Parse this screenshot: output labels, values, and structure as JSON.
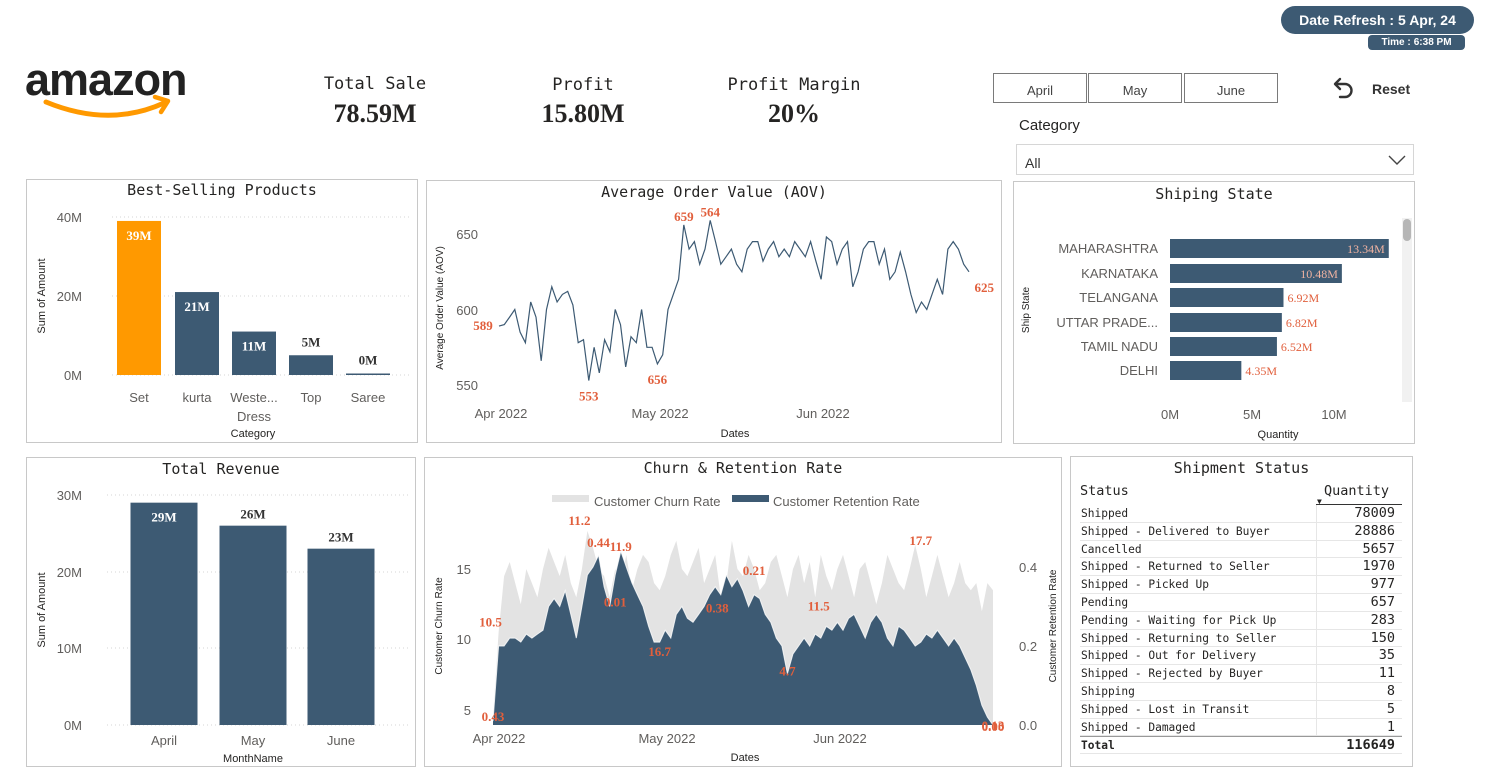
{
  "header": {
    "date_refresh_label": "Date Refresh :",
    "date_refresh_value": "5 Apr, 24",
    "time_label": "Time :",
    "time_value": "6:38 PM",
    "logo_text": "amazon"
  },
  "kpis": [
    {
      "label": "Total Sale",
      "value": "78.59M"
    },
    {
      "label": "Profit",
      "value": "15.80M"
    },
    {
      "label": "Profit Margin",
      "value": "20%"
    }
  ],
  "filters": {
    "months": [
      "April",
      "May",
      "June"
    ],
    "reset_label": "Reset",
    "category_label": "Category",
    "category_value": "All"
  },
  "colors": {
    "accent_orange": "#ff9900",
    "bar_dark": "#3d5a73",
    "label_red": "#e15f3c",
    "churn_grey": "#e3e3e3"
  },
  "best_selling": {
    "title": "Best-Selling Products",
    "ylabel": "Sum of Amount",
    "xlabel": "Category",
    "yticks": [
      "40M",
      "20M",
      "0M"
    ],
    "labels": [
      "39M",
      "21M",
      "11M",
      "5M",
      "0M"
    ],
    "cat_labels": [
      "Set",
      "kurta",
      "Weste...",
      "Top",
      "Saree"
    ],
    "cat_sublabel": "Dress"
  },
  "aov": {
    "title": "Average Order Value (AOV)",
    "ylabel": "Average Order Value (AOV)",
    "xlabel": "Dates",
    "yticks": [
      "650",
      "600",
      "550"
    ],
    "xticks": [
      "Apr 2022",
      "May 2022",
      "Jun 2022"
    ],
    "point_labels": [
      "589",
      "553",
      "656",
      "659",
      "564",
      "625"
    ]
  },
  "ship_state": {
    "title": "Shiping State",
    "ylabel": "Ship State",
    "xlabel": "Quantity",
    "xticks": [
      "0M",
      "5M",
      "10M"
    ],
    "states": [
      "MAHARASHTRA",
      "KARNATAKA",
      "TELANGANA",
      "UTTAR PRADE...",
      "TAMIL NADU",
      "DELHI"
    ],
    "labels": [
      "13.34M",
      "10.48M",
      "6.92M",
      "6.82M",
      "6.52M",
      "4.35M"
    ]
  },
  "total_revenue": {
    "title": "Total Revenue",
    "ylabel": "Sum of Amount",
    "xlabel": "MonthName",
    "yticks": [
      "30M",
      "20M",
      "10M",
      "0M"
    ],
    "labels": [
      "29M",
      "26M",
      "23M"
    ],
    "months": [
      "April",
      "May",
      "June"
    ]
  },
  "churn": {
    "title": "Churn & Retention Rate",
    "legend_churn": "Customer Churn Rate",
    "legend_retention": "Customer Retention Rate",
    "ylabel_left": "Customer Churn Rate",
    "ylabel_right": "Customer Retention Rate",
    "xlabel": "Dates",
    "yticks_left": [
      "15",
      "10",
      "5"
    ],
    "yticks_right": [
      "0.4",
      "0.2",
      "0.0"
    ],
    "xticks": [
      "Apr 2022",
      "May 2022",
      "Jun 2022"
    ],
    "point_labels": [
      "10.5",
      "0.01",
      "17.7",
      "0.43",
      "0.44",
      "11.9",
      "0.21",
      "11.2",
      "0.38",
      "11.5",
      "0.13",
      "16.7",
      "4.7",
      "0.00"
    ]
  },
  "shipment_status": {
    "title": "Shipment Status",
    "col_status": "Status",
    "col_quantity": "Quantity",
    "sort_indicator": "▼",
    "rows": [
      {
        "status": "Shipped",
        "qty": "78009"
      },
      {
        "status": "Shipped - Delivered to Buyer",
        "qty": "28886"
      },
      {
        "status": "Cancelled",
        "qty": "5657"
      },
      {
        "status": "Shipped - Returned to Seller",
        "qty": "1970"
      },
      {
        "status": "Shipped - Picked Up",
        "qty": "977"
      },
      {
        "status": "Pending",
        "qty": "657"
      },
      {
        "status": "Pending - Waiting for Pick Up",
        "qty": "283"
      },
      {
        "status": "Shipped - Returning to Seller",
        "qty": "150"
      },
      {
        "status": "Shipped - Out for Delivery",
        "qty": "35"
      },
      {
        "status": "Shipped - Rejected by Buyer",
        "qty": "11"
      },
      {
        "status": "Shipping",
        "qty": "8"
      },
      {
        "status": "Shipped - Lost in Transit",
        "qty": "5"
      },
      {
        "status": "Shipped - Damaged",
        "qty": "1"
      }
    ],
    "total_label": "Total",
    "total_value": "116649"
  },
  "chart_data": [
    {
      "type": "bar",
      "title": "Best-Selling Products",
      "categories": [
        "Set",
        "kurta",
        "Western Dress",
        "Top",
        "Saree"
      ],
      "values": [
        39,
        21,
        11,
        5,
        0.1
      ],
      "unit": "M",
      "xlabel": "Category",
      "ylabel": "Sum of Amount",
      "ylim": [
        0,
        40
      ],
      "highlight": "Set"
    },
    {
      "type": "line",
      "title": "Average Order Value (AOV)",
      "x": [
        "2022-03-31",
        "2022-04-01",
        "2022-04-02",
        "2022-04-03",
        "2022-04-04",
        "2022-04-05",
        "2022-04-06",
        "2022-04-07",
        "2022-04-08",
        "2022-04-09",
        "2022-04-10",
        "2022-04-11",
        "2022-04-12",
        "2022-04-13",
        "2022-04-14",
        "2022-04-15",
        "2022-04-16",
        "2022-04-17",
        "2022-04-18",
        "2022-04-19",
        "2022-04-20",
        "2022-04-21",
        "2022-04-22",
        "2022-04-23",
        "2022-04-24",
        "2022-04-25",
        "2022-04-26",
        "2022-04-27",
        "2022-04-28",
        "2022-04-29",
        "2022-04-30",
        "2022-05-01",
        "2022-05-02",
        "2022-05-03",
        "2022-05-04",
        "2022-05-05",
        "2022-05-06",
        "2022-05-07",
        "2022-05-08",
        "2022-05-09",
        "2022-05-10",
        "2022-05-11",
        "2022-05-12",
        "2022-05-13",
        "2022-05-14",
        "2022-05-15",
        "2022-05-16",
        "2022-05-17",
        "2022-05-18",
        "2022-05-19",
        "2022-05-20",
        "2022-05-21",
        "2022-05-22",
        "2022-05-23",
        "2022-05-24",
        "2022-05-25",
        "2022-05-26",
        "2022-05-27",
        "2022-05-28",
        "2022-05-29",
        "2022-05-30",
        "2022-05-31",
        "2022-06-01",
        "2022-06-02",
        "2022-06-03",
        "2022-06-04",
        "2022-06-05",
        "2022-06-06",
        "2022-06-07",
        "2022-06-08",
        "2022-06-09",
        "2022-06-10",
        "2022-06-11",
        "2022-06-12",
        "2022-06-13",
        "2022-06-14",
        "2022-06-15",
        "2022-06-16",
        "2022-06-17",
        "2022-06-18",
        "2022-06-19",
        "2022-06-20",
        "2022-06-21",
        "2022-06-22",
        "2022-06-23",
        "2022-06-24",
        "2022-06-25",
        "2022-06-26",
        "2022-06-27",
        "2022-06-28",
        "2022-06-29"
      ],
      "values": [
        589,
        590,
        595,
        600,
        585,
        578,
        605,
        595,
        566,
        600,
        615,
        605,
        610,
        612,
        603,
        578,
        580,
        553,
        575,
        558,
        580,
        572,
        600,
        590,
        562,
        582,
        578,
        600,
        575,
        575,
        564,
        570,
        600,
        610,
        620,
        656,
        640,
        645,
        630,
        640,
        659,
        645,
        630,
        635,
        640,
        630,
        625,
        640,
        645,
        645,
        632,
        640,
        645,
        635,
        640,
        635,
        645,
        640,
        635,
        645,
        632,
        620,
        648,
        645,
        630,
        640,
        645,
        615,
        625,
        640,
        645,
        645,
        630,
        640,
        620,
        625,
        638,
        625,
        610,
        598,
        605,
        600,
        610,
        620,
        610,
        640,
        645,
        640,
        630,
        625
      ],
      "xlabel": "Dates",
      "ylabel": "Average Order Value (AOV)",
      "ylim": [
        545,
        660
      ],
      "labeled_points": [
        {
          "x": "2022-03-31",
          "y": 589
        },
        {
          "x": "2022-04-17",
          "y": 553
        },
        {
          "x": "2022-04-30",
          "y": 564
        },
        {
          "x": "2022-05-05",
          "y": 656
        },
        {
          "x": "2022-05-10",
          "y": 659
        },
        {
          "x": "2022-06-29",
          "y": 625
        }
      ]
    },
    {
      "type": "bar",
      "orientation": "horizontal",
      "title": "Shiping State",
      "categories": [
        "MAHARASHTRA",
        "KARNATAKA",
        "TELANGANA",
        "UTTAR PRADESH",
        "TAMIL NADU",
        "DELHI"
      ],
      "values": [
        13.34,
        10.48,
        6.92,
        6.82,
        6.52,
        4.35
      ],
      "unit": "M",
      "xlabel": "Quantity",
      "ylabel": "Ship State",
      "xlim": [
        0,
        14
      ]
    },
    {
      "type": "bar",
      "title": "Total Revenue",
      "categories": [
        "April",
        "May",
        "June"
      ],
      "values": [
        29,
        26,
        23
      ],
      "unit": "M",
      "xlabel": "MonthName",
      "ylabel": "Sum of Amount",
      "ylim": [
        0,
        30
      ]
    },
    {
      "type": "area",
      "title": "Churn & Retention Rate",
      "x": [
        "2022-03-31",
        "2022-04-01",
        "2022-04-02",
        "2022-04-03",
        "2022-04-04",
        "2022-04-05",
        "2022-04-06",
        "2022-04-07",
        "2022-04-08",
        "2022-04-09",
        "2022-04-10",
        "2022-04-11",
        "2022-04-12",
        "2022-04-13",
        "2022-04-14",
        "2022-04-15",
        "2022-04-16",
        "2022-04-17",
        "2022-04-18",
        "2022-04-19",
        "2022-04-20",
        "2022-04-21",
        "2022-04-22",
        "2022-04-23",
        "2022-04-24",
        "2022-04-25",
        "2022-04-26",
        "2022-04-27",
        "2022-04-28",
        "2022-04-29",
        "2022-04-30",
        "2022-05-01",
        "2022-05-02",
        "2022-05-03",
        "2022-05-04",
        "2022-05-05",
        "2022-05-06",
        "2022-05-07",
        "2022-05-08",
        "2022-05-09",
        "2022-05-10",
        "2022-05-11",
        "2022-05-12",
        "2022-05-13",
        "2022-05-14",
        "2022-05-15",
        "2022-05-16",
        "2022-05-17",
        "2022-05-18",
        "2022-05-19",
        "2022-05-20",
        "2022-05-21",
        "2022-05-22",
        "2022-05-23",
        "2022-05-24",
        "2022-05-25",
        "2022-05-26",
        "2022-05-27",
        "2022-05-28",
        "2022-05-29",
        "2022-05-30",
        "2022-05-31",
        "2022-06-01",
        "2022-06-02",
        "2022-06-03",
        "2022-06-04",
        "2022-06-05",
        "2022-06-06",
        "2022-06-07",
        "2022-06-08",
        "2022-06-09",
        "2022-06-10",
        "2022-06-11",
        "2022-06-12",
        "2022-06-13",
        "2022-06-14",
        "2022-06-15",
        "2022-06-16",
        "2022-06-17",
        "2022-06-18",
        "2022-06-19",
        "2022-06-20",
        "2022-06-21",
        "2022-06-22",
        "2022-06-23",
        "2022-06-24",
        "2022-06-25",
        "2022-06-26",
        "2022-06-27",
        "2022-06-28",
        "2022-06-29"
      ],
      "series": [
        {
          "name": "Customer Churn Rate",
          "axis": "left",
          "values": [
            4.5,
            10.5,
            14.5,
            15.5,
            14,
            12.5,
            15,
            14,
            13,
            15,
            16.5,
            15.5,
            14.5,
            16,
            14,
            13,
            15,
            17.7,
            16.5,
            15,
            14.5,
            13,
            15,
            14,
            16,
            13.5,
            15,
            16,
            15.5,
            14,
            13.5,
            14.5,
            16,
            17,
            15,
            14.5,
            15.5,
            16.5,
            14,
            15,
            16,
            13,
            14,
            17,
            15,
            14.5,
            16,
            15,
            13.5,
            14,
            15.5,
            16,
            14.5,
            13,
            15,
            16,
            14,
            15.5,
            13,
            16,
            14.5,
            13.5,
            15,
            16,
            14.5,
            13,
            15,
            15.5,
            14,
            12.5,
            14,
            16,
            15,
            14,
            13.5,
            15,
            16.7,
            15,
            13,
            14.5,
            16,
            14.5,
            13,
            14,
            15.5,
            14,
            13.5,
            14,
            12,
            14,
            13.5
          ]
        },
        {
          "name": "Customer Retention Rate",
          "axis": "right",
          "values": [
            0.01,
            0.2,
            0.2,
            0.22,
            0.22,
            0.21,
            0.23,
            0.22,
            0.23,
            0.24,
            0.3,
            0.32,
            0.3,
            0.34,
            0.28,
            0.22,
            0.3,
            0.38,
            0.4,
            0.43,
            0.35,
            0.3,
            0.38,
            0.44,
            0.4,
            0.36,
            0.33,
            0.3,
            0.25,
            0.21,
            0.21,
            0.24,
            0.22,
            0.28,
            0.3,
            0.27,
            0.26,
            0.28,
            0.3,
            0.33,
            0.35,
            0.33,
            0.38,
            0.35,
            0.37,
            0.34,
            0.3,
            0.33,
            0.32,
            0.28,
            0.26,
            0.22,
            0.2,
            0.13,
            0.18,
            0.2,
            0.22,
            0.2,
            0.23,
            0.22,
            0.25,
            0.24,
            0.26,
            0.24,
            0.27,
            0.28,
            0.25,
            0.22,
            0.26,
            0.28,
            0.26,
            0.22,
            0.2,
            0.25,
            0.24,
            0.22,
            0.2,
            0.21,
            0.23,
            0.22,
            0.24,
            0.22,
            0.2,
            0.22,
            0.2,
            0.17,
            0.14,
            0.1,
            0.05,
            0.02,
            0.0
          ]
        }
      ],
      "xlabel": "Dates",
      "ylabel_left": "Customer Churn Rate",
      "ylabel_right": "Customer Retention Rate",
      "ylim_left": [
        4.2,
        17.7
      ],
      "ylim_right": [
        0,
        0.45
      ],
      "labeled_points": [
        {
          "series": "Customer Churn Rate",
          "x": "2022-04-01",
          "y": 10.5
        },
        {
          "series": "Customer Churn Rate",
          "x": "2022-04-17",
          "y": 17.7
        },
        {
          "series": "Customer Churn Rate",
          "x": "2022-04-22",
          "y": 11.9
        },
        {
          "series": "Customer Churn Rate",
          "x": "2022-05-10",
          "y": 11.2
        },
        {
          "series": "Customer Churn Rate",
          "x": "2022-05-29",
          "y": 11.5
        },
        {
          "series": "Customer Churn Rate",
          "x": "2022-06-16",
          "y": 16.7
        },
        {
          "series": "Customer Churn Rate",
          "x": "2022-06-29",
          "y": 4.7
        },
        {
          "series": "Customer Retention Rate",
          "x": "2022-03-31",
          "y": 0.01
        },
        {
          "series": "Customer Retention Rate",
          "x": "2022-04-19",
          "y": 0.43
        },
        {
          "series": "Customer Retention Rate",
          "x": "2022-04-23",
          "y": 0.44
        },
        {
          "series": "Customer Retention Rate",
          "x": "2022-04-30",
          "y": 0.21
        },
        {
          "series": "Customer Retention Rate",
          "x": "2022-05-17",
          "y": 0.38
        },
        {
          "series": "Customer Retention Rate",
          "x": "2022-05-23",
          "y": 0.13
        },
        {
          "series": "Customer Retention Rate",
          "x": "2022-06-29",
          "y": 0.0
        }
      ]
    }
  ]
}
